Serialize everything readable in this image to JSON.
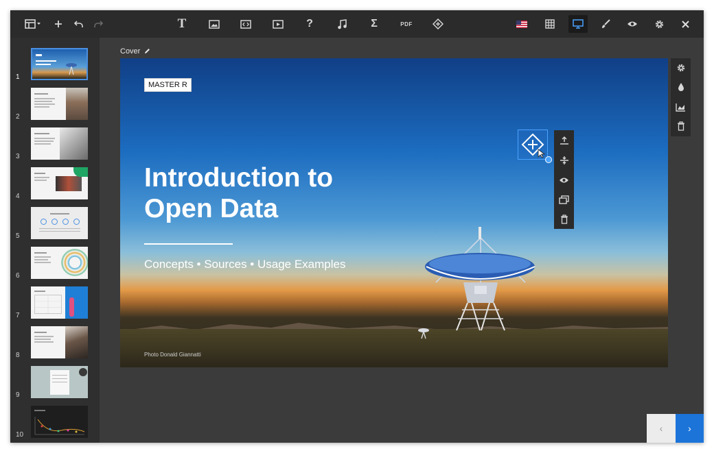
{
  "toolbar": {
    "left_icons": [
      "layout-icon",
      "add-icon",
      "undo-icon",
      "redo-icon"
    ],
    "center_icons": [
      "text-icon",
      "image-icon",
      "embed-code-icon",
      "video-icon",
      "question-icon",
      "music-icon",
      "sigma-icon",
      "pdf-icon",
      "hotspot-icon"
    ],
    "text_label": "T",
    "question_label": "?",
    "sigma_label": "Σ",
    "pdf_label": "PDF",
    "right_icons": [
      "us-flag-icon",
      "grid-icon",
      "presentation-icon",
      "brush-icon",
      "eye-icon",
      "gear-icon",
      "close-icon"
    ]
  },
  "sidebar": {
    "slides": [
      {
        "number": "1",
        "selected": true
      },
      {
        "number": "2"
      },
      {
        "number": "3"
      },
      {
        "number": "4"
      },
      {
        "number": "5"
      },
      {
        "number": "6"
      },
      {
        "number": "7"
      },
      {
        "number": "8"
      },
      {
        "number": "9"
      },
      {
        "number": "10"
      }
    ]
  },
  "canvas": {
    "label": "Cover",
    "edit_icon": "pencil-icon"
  },
  "slide": {
    "master_tag": "MASTER R",
    "title_line1": "Introduction to",
    "title_line2": "Open Data",
    "subtitle": "Concepts • Sources • Usage Examples",
    "credit": "Photo Donald Giannatti",
    "colors": {
      "sky_top": "#103f86",
      "horizon": "#e39a48",
      "ground": "#2a261a"
    }
  },
  "element_tools": [
    "bring-forward-icon",
    "align-icon",
    "visibility-icon",
    "duplicate-icon",
    "trash-icon"
  ],
  "slide_tools": [
    "gear-icon",
    "drop-icon",
    "chart-icon",
    "trash-icon"
  ],
  "nav": {
    "prev": "‹",
    "next": "›",
    "accent": "#1c74d9"
  }
}
